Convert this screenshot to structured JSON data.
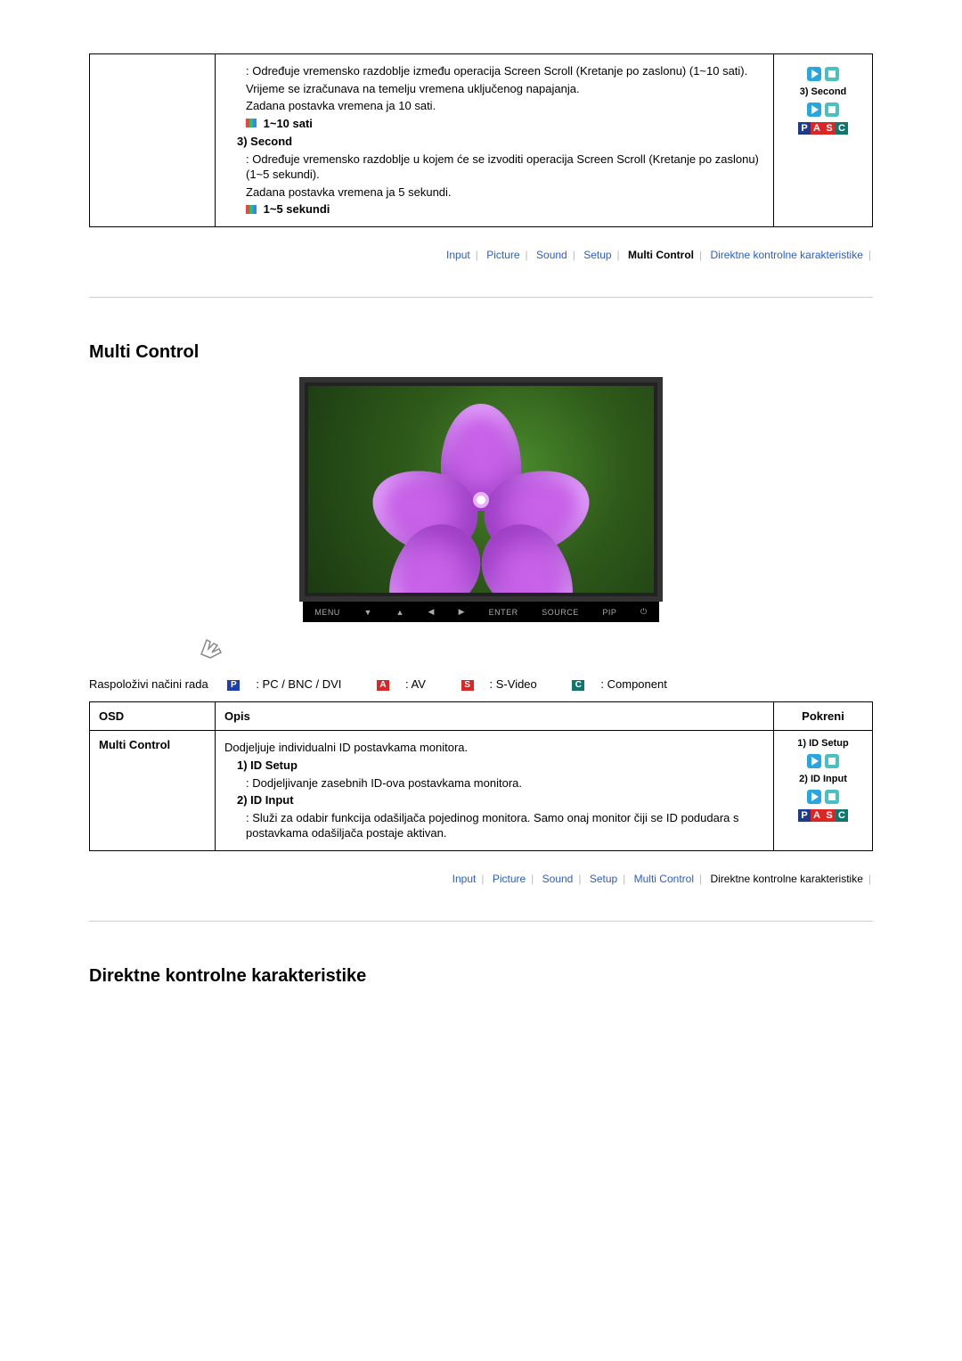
{
  "section1": {
    "desc_p1": ": Određuje vremensko razdoblje između operacija Screen Scroll (Kretanje po zaslonu) (1~10 sati).",
    "desc_p2": "Vrijeme se izračunava na temelju vremena uključenog napajanja.",
    "desc_p3": "Zadana postavka vremena ja 10 sati.",
    "range1": "1~10 sati",
    "heading2": "3) Second",
    "desc_p4": ": Određuje vremensko razdoblje u kojem će se izvoditi operacija Screen Scroll (Kretanje po zaslonu) (1~5 sekundi).",
    "desc_p5": "Zadana postavka vremena ja 5 sekundi.",
    "range2": "1~5 sekundi",
    "right_label": "3) Second"
  },
  "nav1": {
    "input": "Input",
    "picture": "Picture",
    "sound": "Sound",
    "setup": "Setup",
    "multi": "Multi Control",
    "direkt": "Direktne kontrolne karakteristike"
  },
  "multi_title": "Multi Control",
  "button_bar": {
    "menu": "MENU",
    "enter": "ENTER",
    "source": "SOURCE",
    "pip": "PIP"
  },
  "modes": {
    "label": "Raspoloživi načini rada",
    "p": ": PC / BNC / DVI",
    "a": ": AV",
    "s": ": S-Video",
    "c": ": Component"
  },
  "table_headers": {
    "osd": "OSD",
    "opis": "Opis",
    "pokreni": "Pokreni"
  },
  "multi_table": {
    "left": "Multi Control",
    "intro": "Dodjeljuje individualni ID postavkama monitora.",
    "h1": "1) ID Setup",
    "d1": ": Dodjeljivanje zasebnih ID-ova postavkama monitora.",
    "h2": "2) ID Input",
    "d2": ": Služi za odabir funkcija odašiljača pojedinog monitora. Samo onaj monitor čiji se ID podudara s postavkama odašiljača postaje aktivan.",
    "right1": "1) ID Setup",
    "right2": "2) ID Input"
  },
  "direkt_title": "Direktne kontrolne karakteristike"
}
